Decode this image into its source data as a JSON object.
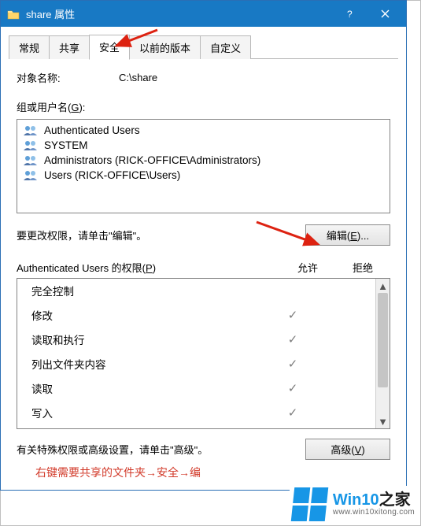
{
  "titlebar": {
    "title": "share 属性"
  },
  "tabs": [
    {
      "label": "常规",
      "active": false
    },
    {
      "label": "共享",
      "active": false
    },
    {
      "label": "安全",
      "active": true
    },
    {
      "label": "以前的版本",
      "active": false
    },
    {
      "label": "自定义",
      "active": false
    }
  ],
  "object": {
    "label": "对象名称:",
    "value": "C:\\share"
  },
  "users": {
    "label_prefix": "组或用户名(",
    "hotkey": "G",
    "label_suffix": "):",
    "items": [
      "Authenticated Users",
      "SYSTEM",
      "Administrators (RICK-OFFICE\\Administrators)",
      "Users (RICK-OFFICE\\Users)"
    ]
  },
  "edit": {
    "hint": "要更改权限，请单击\"编辑\"。",
    "button_prefix": "编辑(",
    "button_hotkey": "E",
    "button_suffix": ")..."
  },
  "permissions": {
    "header_prefix": "Authenticated Users 的权限(",
    "header_hotkey": "P",
    "header_suffix": ")",
    "col_allow": "允许",
    "col_deny": "拒绝",
    "rows": [
      {
        "name": "完全控制",
        "allow": false,
        "deny": false
      },
      {
        "name": "修改",
        "allow": true,
        "deny": false
      },
      {
        "name": "读取和执行",
        "allow": true,
        "deny": false
      },
      {
        "name": "列出文件夹内容",
        "allow": true,
        "deny": false
      },
      {
        "name": "读取",
        "allow": true,
        "deny": false
      },
      {
        "name": "写入",
        "allow": true,
        "deny": false
      }
    ]
  },
  "advanced": {
    "hint": "有关特殊权限或高级设置，请单击\"高级\"。",
    "button_prefix": "高级(",
    "button_hotkey": "V",
    "button_suffix": ")"
  },
  "footer_hint": "右键需要共享的文件夹→安全→编",
  "watermark": {
    "brand_prefix": "Win10",
    "brand_suffix": "之家",
    "url": "www.win10xitong.com"
  }
}
